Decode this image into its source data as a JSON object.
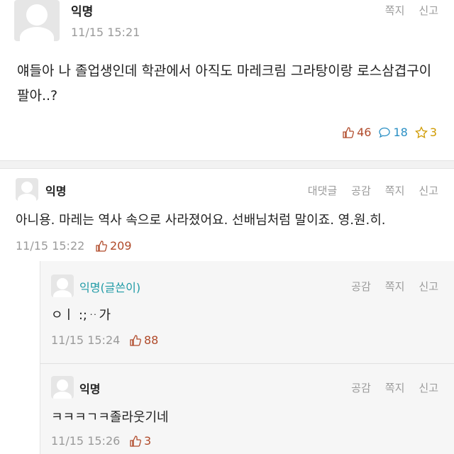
{
  "post": {
    "author": "익명",
    "timestamp": "11/15 15:21",
    "actions": [
      "쪽지",
      "신고"
    ],
    "text_line1": "얘들아 나 졸업생인데 학관에서 아직도 마레크림 그라탕이랑 로스삼겹구이",
    "text_line2": "팔아..?",
    "likes": "46",
    "comments": "18",
    "scraps": "3"
  },
  "comment1": {
    "author": "익명",
    "actions": [
      "대댓글",
      "공감",
      "쪽지",
      "신고"
    ],
    "text": "아니용. 마레는 역사 속으로 사라졌어요. 선배님처럼 말이죠. 영.원.히.",
    "timestamp": "11/15 15:22",
    "likes": "209"
  },
  "reply1": {
    "author": "익명(글쓴이)",
    "actions": [
      "공감",
      "쪽지",
      "신고"
    ],
    "text": "ㅇㅣ :;ᆢ가",
    "timestamp": "11/15 15:24",
    "likes": "88"
  },
  "reply2": {
    "author": "익명",
    "actions": [
      "공감",
      "쪽지",
      "신고"
    ],
    "text": "ㅋㅋㅋㄱㅋ졸라웃기네",
    "timestamp": "11/15 15:26",
    "likes": "3"
  },
  "colors": {
    "like": "#b04a2a",
    "comment": "#2a8fc4",
    "scrap": "#d09a00",
    "writer": "#1e9aa5"
  },
  "icons": {
    "like": "thumbs-up-icon",
    "comment": "speech-bubble-icon",
    "scrap": "star-icon",
    "avatar": "default-user-icon"
  }
}
